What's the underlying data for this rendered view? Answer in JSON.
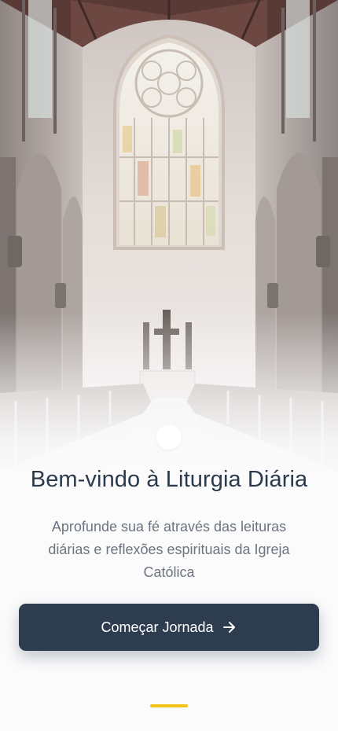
{
  "onboarding": {
    "title": "Bem-vindo à Liturgia Diária",
    "subtitle": "Aprofunde sua fé através das leituras diárias e reflexões espirituais da Igreja Católica",
    "cta_label": "Começar Jornada",
    "cta_icon": "arrow-right-icon",
    "hero_image": "church-interior-image",
    "page_indicator_color": "#f2c318",
    "button_color": "#2e3c4f"
  }
}
